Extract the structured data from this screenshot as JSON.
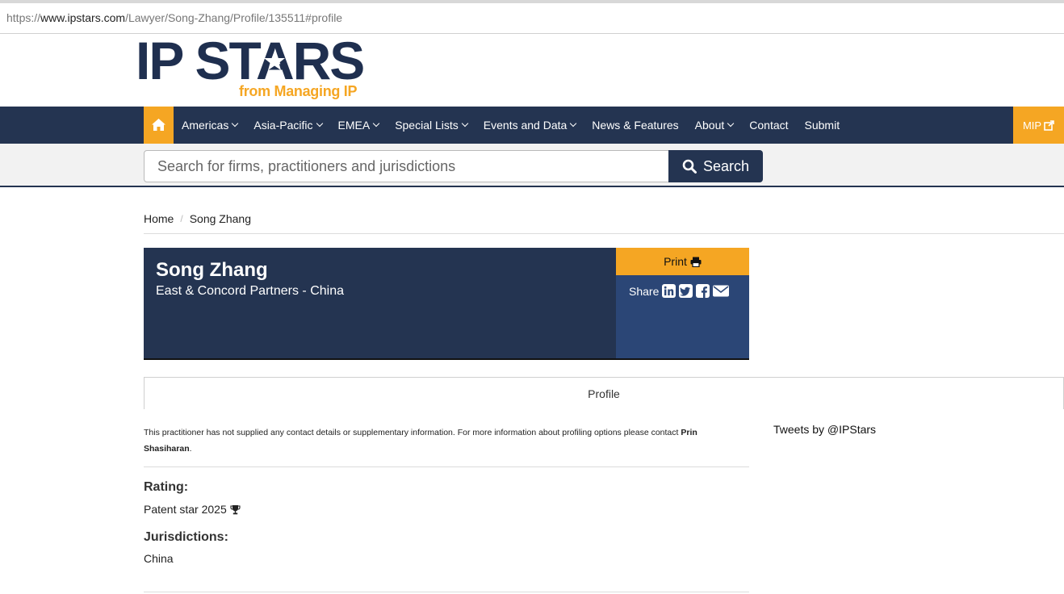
{
  "browser": {
    "url_prefix": "https://",
    "url_host": "www.ipstars.com",
    "url_path": "/Lawyer/Song-Zhang/Profile/135511#profile"
  },
  "logo": {
    "title": "IP STARS",
    "subtitle": "from Managing IP"
  },
  "nav": {
    "home_icon": "home-icon",
    "items": [
      {
        "label": "Americas",
        "dropdown": true
      },
      {
        "label": "Asia-Pacific",
        "dropdown": true
      },
      {
        "label": "EMEA",
        "dropdown": true
      },
      {
        "label": "Special Lists",
        "dropdown": true
      },
      {
        "label": "Events and Data",
        "dropdown": true
      },
      {
        "label": "News & Features",
        "dropdown": false
      },
      {
        "label": "About",
        "dropdown": true
      },
      {
        "label": "Contact",
        "dropdown": false
      },
      {
        "label": "Submit",
        "dropdown": false
      }
    ],
    "mip_label": "MIP",
    "accent_color": "#f5a623",
    "bar_color": "#243451"
  },
  "search": {
    "placeholder": "Search for firms, practitioners and jurisdictions",
    "button_label": "Search"
  },
  "breadcrumb": {
    "home": "Home",
    "current": "Song Zhang"
  },
  "profile": {
    "name": "Song Zhang",
    "firm": "East & Concord Partners - China",
    "print_label": "Print",
    "share_label": "Share",
    "share_icons": [
      "linkedin-icon",
      "twitter-icon",
      "facebook-icon",
      "email-icon"
    ]
  },
  "tabs": {
    "profile": "Profile"
  },
  "content": {
    "note_text": "This practitioner has not supplied any contact details or supplementary information. For more information about profiling options please contact ",
    "note_contact": "Prin Shasiharan",
    "note_end": ".",
    "rating_heading": "Rating:",
    "rating_value": "Patent star 2025",
    "jurisdictions_heading": "Jurisdictions:",
    "jurisdictions_value": "China"
  },
  "sidebar": {
    "tweets_label": "Tweets by @IPStars"
  }
}
